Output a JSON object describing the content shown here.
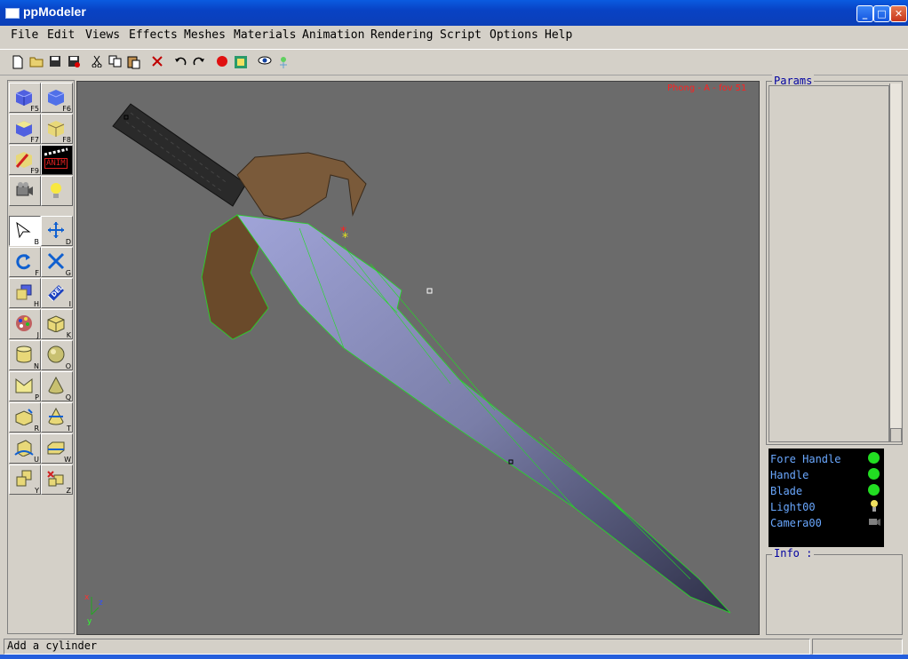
{
  "window": {
    "title": "ppModeler"
  },
  "menu": [
    "File",
    "Edit",
    "Views",
    "Effects",
    "Meshes",
    "Materials",
    "Animation",
    "Rendering",
    "Script",
    "Options",
    "Help"
  ],
  "toolbar": {
    "icons": [
      "new-file-icon",
      "open-folder-icon",
      "save-icon",
      "save-as-icon",
      "cut-icon",
      "copy-icon",
      "paste-icon",
      "delete-icon",
      "undo-icon",
      "redo-icon",
      "record-icon",
      "render-image-icon",
      "eye-icon",
      "light-probe-icon"
    ]
  },
  "palette": {
    "view_keys": [
      "F5",
      "F6",
      "F7",
      "F8",
      "F9",
      "ANIM"
    ],
    "tool_keys": [
      "B",
      "D",
      "F",
      "G",
      "H",
      "I",
      "J",
      "K",
      "N",
      "O",
      "P",
      "Q",
      "R",
      "T",
      "U",
      "W",
      "Y",
      "Z"
    ],
    "anim_label": "ANIM",
    "del_label": "DEL"
  },
  "viewport": {
    "render_mode": "Phong - A - fov 51",
    "axis_x": "x",
    "axis_y": "y",
    "axis_z": "z"
  },
  "params": {
    "label": "Params"
  },
  "objects": [
    {
      "name": "Fore Handle",
      "icon": "green-dot"
    },
    {
      "name": "Handle",
      "icon": "green-dot"
    },
    {
      "name": "Blade",
      "icon": "green-dot"
    },
    {
      "name": "Light00",
      "icon": "bulb-icon"
    },
    {
      "name": "Camera00",
      "icon": "camera-icon"
    }
  ],
  "info": {
    "label": "Info :"
  },
  "status": {
    "text": "Add a cylinder"
  },
  "colors": {
    "title_bar": "#0a5be0",
    "viewport_bg": "#6b6b6b",
    "wire": "#22dd22",
    "object_list_text": "#6aa8ff"
  }
}
